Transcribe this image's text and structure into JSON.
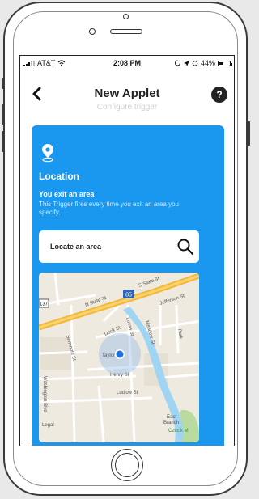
{
  "status_bar": {
    "carrier": "AT&T",
    "time": "2:08 PM",
    "battery": "44%",
    "battery_level": 0.44
  },
  "nav": {
    "title": "New Applet",
    "subtitle": "Configure trigger",
    "help_label": "?"
  },
  "trigger_card": {
    "service_title": "Location",
    "trigger_name": "You exit an area",
    "trigger_description": "This Trigger fires every time you exit an area you specify.",
    "color": "#1a97ee"
  },
  "search": {
    "placeholder": "Locate an area"
  },
  "map": {
    "labels": {
      "n_state": "N State St",
      "s_state": "S State St",
      "hwy": "85",
      "route": "137",
      "jefferson": "Jefferson St",
      "dock": "Dock St",
      "lucas": "Lucas St",
      "meadow": "Meadow St",
      "seminole": "Seminole St",
      "henry": "Henry St",
      "ludlow": "Ludlow St",
      "taylor": "Taylor",
      "washington": "Washington Blvd",
      "east_branch_1": "East",
      "east_branch_2": "Branch",
      "czecik": "Czecik M",
      "legal": "Legal",
      "park": "Park"
    }
  }
}
